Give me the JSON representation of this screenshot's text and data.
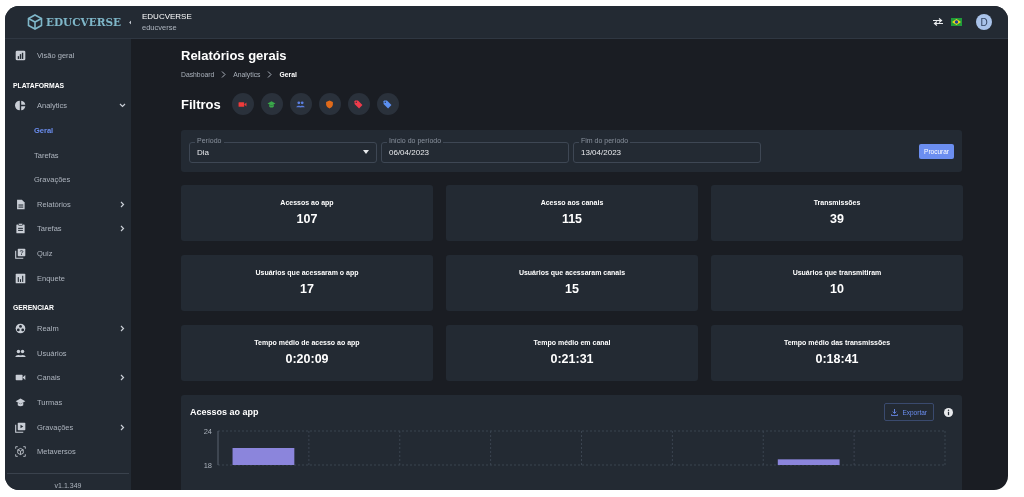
{
  "sidebar": {
    "logo": "EDUCVERSE",
    "items": [
      {
        "kind": "link",
        "label": "Visão geral"
      },
      {
        "kind": "header",
        "label": "PLATAFORMAS"
      },
      {
        "kind": "group",
        "label": "Analytics",
        "expanded": true,
        "children": [
          {
            "label": "Geral",
            "selected": true
          },
          {
            "label": "Tarefas",
            "selected": false
          },
          {
            "label": "Gravações",
            "selected": false
          }
        ]
      },
      {
        "kind": "group",
        "label": "Relatórios",
        "expanded": false
      },
      {
        "kind": "group",
        "label": "Tarefas",
        "expanded": false
      },
      {
        "kind": "link",
        "label": "Quiz"
      },
      {
        "kind": "link",
        "label": "Enquete"
      },
      {
        "kind": "header",
        "label": "GERENCIAR"
      },
      {
        "kind": "group",
        "label": "Realm",
        "expanded": false
      },
      {
        "kind": "link",
        "label": "Usuários"
      },
      {
        "kind": "group",
        "label": "Canais",
        "expanded": false
      },
      {
        "kind": "link",
        "label": "Turmas"
      },
      {
        "kind": "group",
        "label": "Gravações",
        "expanded": false
      },
      {
        "kind": "link",
        "label": "Metaversos"
      }
    ],
    "version": "v1.1.349"
  },
  "topbar": {
    "title": "EDUCVERSE",
    "subtitle": "educverse",
    "avatar": "D"
  },
  "page": {
    "title": "Relatórios gerais",
    "breadcrumb": [
      {
        "label": "Dashboard",
        "current": false
      },
      {
        "label": "Analytics",
        "current": false
      },
      {
        "label": "Geral",
        "current": true
      }
    ]
  },
  "filters": {
    "label": "Filtros",
    "items": [
      {
        "color": "#ef3b3b"
      },
      {
        "color": "#3aa84a"
      },
      {
        "color": "#5b7fe0"
      },
      {
        "color": "#e06a1a"
      },
      {
        "color": "#ef3b4b"
      },
      {
        "color": "#5b8ff0"
      }
    ]
  },
  "form": {
    "fields": [
      {
        "kind": "select",
        "label": "Período",
        "value": "Dia"
      },
      {
        "kind": "text",
        "label": "Início do período",
        "value": "06/04/2023"
      },
      {
        "kind": "text",
        "label": "Fim do período",
        "value": "13/04/2023"
      }
    ],
    "button": "Procurar"
  },
  "stats": [
    {
      "label": "Acessos ao app",
      "value": "107"
    },
    {
      "label": "Acesso aos canais",
      "value": "115"
    },
    {
      "label": "Transmissões",
      "value": "39"
    },
    {
      "label": "Usuários que acessaram o app",
      "value": "17"
    },
    {
      "label": "Usuários que acessaram canais",
      "value": "15"
    },
    {
      "label": "Usuários que transmitiram",
      "value": "10"
    },
    {
      "label": "Tempo médio de acesso ao app",
      "value": "0:20:09"
    },
    {
      "label": "Tempo médio em canal",
      "value": "0:21:31"
    },
    {
      "label": "Tempo médio das transmissões",
      "value": "0:18:41"
    }
  ],
  "chart_card": {
    "title": "Acessos ao app",
    "export": "Exportar",
    "chart_data": {
      "type": "bar",
      "values": [
        21,
        null,
        null,
        null,
        null,
        null,
        19,
        null
      ],
      "ylim": [
        18,
        24
      ],
      "yticks": [
        18,
        24
      ]
    }
  }
}
